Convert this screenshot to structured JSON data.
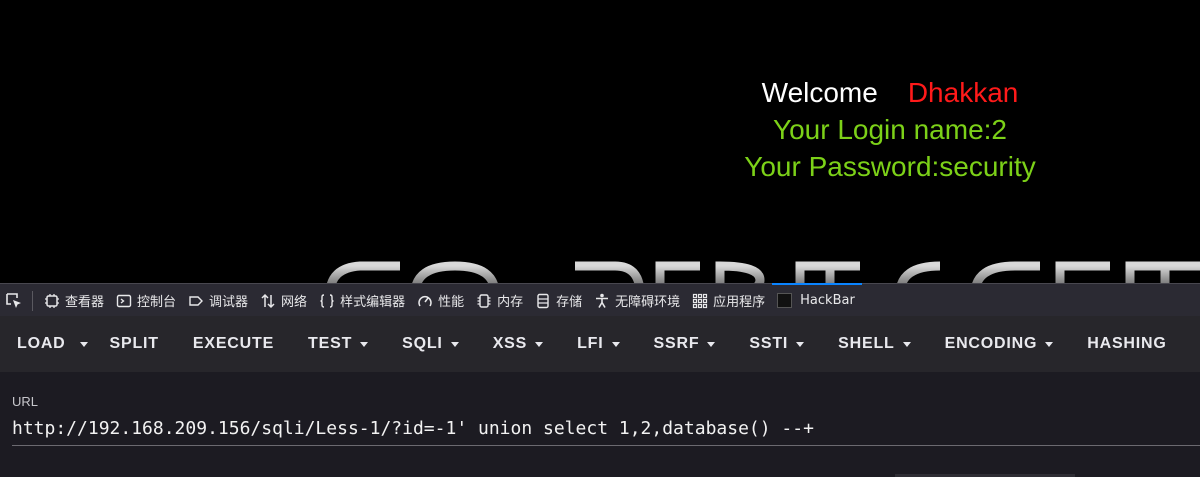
{
  "page": {
    "welcome_label": "Welcome",
    "user_name": "Dhakkan",
    "login_line": "Your Login name:2",
    "password_line": "Your Password:security"
  },
  "devtools": {
    "tabs": [
      {
        "label": "查看器",
        "icon": "inspector-icon"
      },
      {
        "label": "控制台",
        "icon": "console-icon"
      },
      {
        "label": "调试器",
        "icon": "debugger-icon"
      },
      {
        "label": "网络",
        "icon": "network-icon"
      },
      {
        "label": "样式编辑器",
        "icon": "style-editor-icon"
      },
      {
        "label": "性能",
        "icon": "performance-icon"
      },
      {
        "label": "内存",
        "icon": "memory-icon"
      },
      {
        "label": "存储",
        "icon": "storage-icon"
      },
      {
        "label": "无障碍环境",
        "icon": "accessibility-icon"
      },
      {
        "label": "应用程序",
        "icon": "application-icon"
      },
      {
        "label": "HackBar",
        "icon": "hackbar-icon",
        "active": true
      }
    ],
    "active_color": "#0a84ff"
  },
  "hackbar": {
    "buttons": [
      "LOAD",
      "SPLIT",
      "EXECUTE",
      "TEST",
      "SQLI",
      "XSS",
      "LFI",
      "SSRF",
      "SSTI",
      "SHELL",
      "ENCODING",
      "HASHING"
    ],
    "url_label": "URL",
    "url_value": "http://192.168.209.156/sqli/Less-1/?id=-1' union select 1,2,database() --+"
  },
  "colors": {
    "user_name": "#ff1a1a",
    "info_text": "#7cd118",
    "welcome_text": "#ffffff"
  }
}
